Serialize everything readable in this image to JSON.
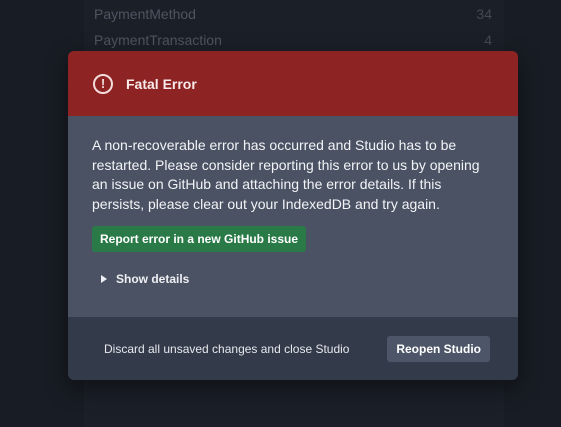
{
  "background": {
    "rows": [
      {
        "label": "PaymentMethod",
        "count": "34"
      },
      {
        "label": "PaymentTransaction",
        "count": "4"
      }
    ]
  },
  "dialog": {
    "icon": "alert-circle-icon",
    "title": "Fatal Error",
    "message": "A non-recoverable error has occurred and Studio has to be restarted. Please consider reporting this error to us by opening an issue on GitHub and attaching the error details. If this persists, please clear out your IndexedDB and try again.",
    "report_button": "Report error in a new GitHub issue",
    "details_toggle": "Show details",
    "discard_link": "Discard all unsaved changes and close Studio",
    "reopen_button": "Reopen Studio"
  },
  "colors": {
    "header": "#8d2423",
    "body": "#4a5263",
    "footer": "#333a49",
    "report_button": "#2a7a48",
    "page_background": "#1b1f29"
  }
}
